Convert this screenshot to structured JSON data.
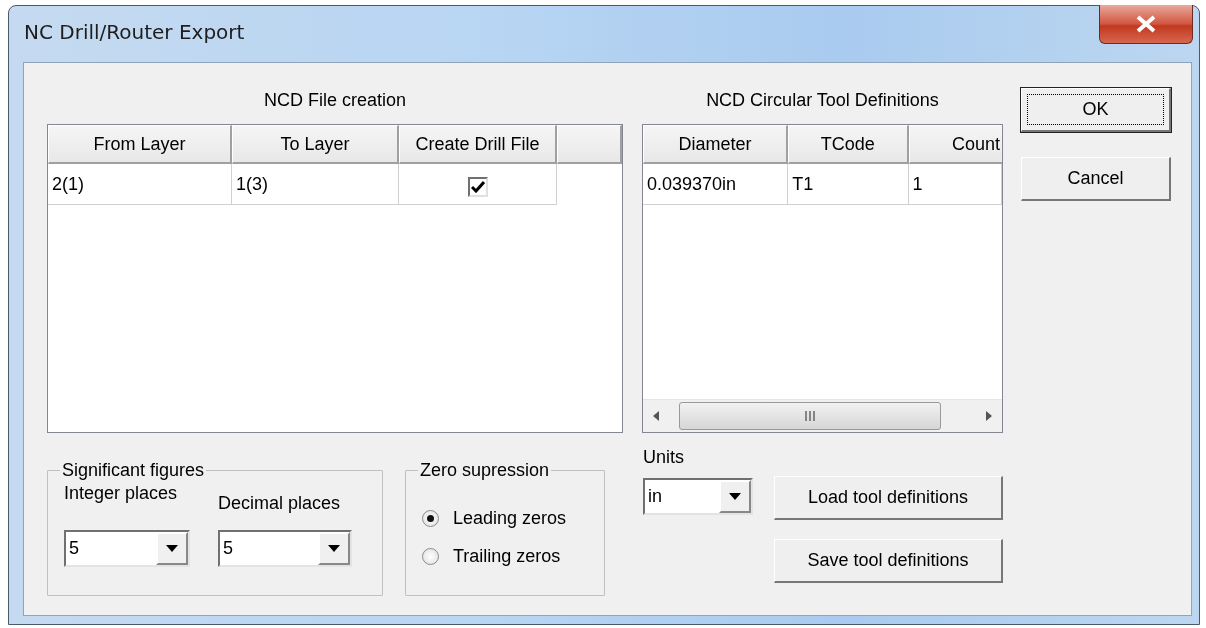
{
  "window": {
    "title": "NC Drill/Router Export"
  },
  "file_creation": {
    "title": "NCD File creation",
    "columns": [
      "From Layer",
      "To Layer",
      "Create Drill File"
    ],
    "rows": [
      {
        "from_layer": "2(1)",
        "to_layer": "1(3)",
        "create_drill_file": true
      }
    ]
  },
  "tool_definitions": {
    "title": "NCD Circular Tool Definitions",
    "columns": [
      "Diameter",
      "TCode",
      "Count"
    ],
    "rows": [
      {
        "cells": [
          "0.039370in",
          "T1",
          "1"
        ]
      }
    ]
  },
  "significant_figures": {
    "title": "Significant figures",
    "fields": [
      {
        "label": "Integer places",
        "value": "5"
      },
      {
        "label": "Decimal places",
        "value": "5"
      }
    ]
  },
  "zero_suppression": {
    "title": "Zero supression",
    "options": [
      {
        "label": "Leading zeros",
        "selected": true
      },
      {
        "label": "Trailing zeros",
        "selected": false
      }
    ]
  },
  "units": {
    "label": "Units",
    "value": "in"
  },
  "tool_buttons": [
    {
      "label": "Load tool definitions"
    },
    {
      "label": "Save tool definitions"
    }
  ],
  "dialog_buttons": [
    {
      "label": "OK",
      "focused": true
    },
    {
      "label": "Cancel",
      "focused": false
    }
  ]
}
